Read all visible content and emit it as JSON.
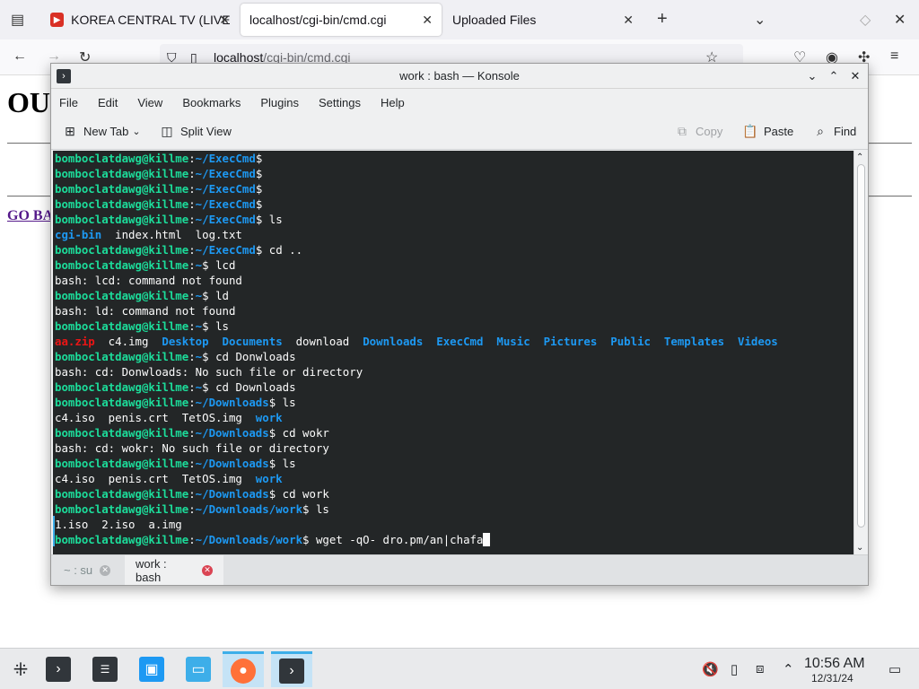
{
  "browser": {
    "tabs": [
      {
        "label": "KOREA CENTRAL TV (LIVES",
        "close": "✕"
      },
      {
        "label": "localhost/cgi-bin/cmd.cgi",
        "close": "✕"
      },
      {
        "label": "Uploaded Files",
        "close": "✕"
      }
    ],
    "new_tab": "+",
    "url_host": "localhost",
    "url_path": "/cgi-bin/cmd.cgi"
  },
  "page": {
    "heading": "OU",
    "link": "GO BA"
  },
  "konsole": {
    "title": "work : bash — Konsole",
    "menu": [
      "File",
      "Edit",
      "View",
      "Bookmarks",
      "Plugins",
      "Settings",
      "Help"
    ],
    "toolbar": {
      "new_tab": "New Tab",
      "split_view": "Split View",
      "copy": "Copy",
      "paste": "Paste",
      "find": "Find"
    },
    "terminal": {
      "user": "bomboclatdawg@killme",
      "lines": [
        {
          "path": "~/ExecCmd",
          "cmd": ""
        },
        {
          "path": "~/ExecCmd",
          "cmd": ""
        },
        {
          "path": "~/ExecCmd",
          "cmd": ""
        },
        {
          "path": "~/ExecCmd",
          "cmd": ""
        },
        {
          "path": "~/ExecCmd",
          "cmd": " ls"
        },
        {
          "out": [
            {
              "t": "cgi-bin",
              "c": "dir"
            },
            {
              "t": "  index.html  log.txt",
              "c": ""
            }
          ]
        },
        {
          "path": "~/ExecCmd",
          "cmd": " cd .."
        },
        {
          "path": "~",
          "cmd": " lcd"
        },
        {
          "out": [
            {
              "t": "bash: lcd: command not found",
              "c": ""
            }
          ]
        },
        {
          "path": "~",
          "cmd": " ld"
        },
        {
          "out": [
            {
              "t": "bash: ld: command not found",
              "c": ""
            }
          ]
        },
        {
          "path": "~",
          "cmd": " ls"
        },
        {
          "out": [
            {
              "t": "aa.zip",
              "c": "arch"
            },
            {
              "t": "  c4.img  ",
              "c": ""
            },
            {
              "t": "Desktop",
              "c": "dir"
            },
            {
              "t": "  ",
              "c": ""
            },
            {
              "t": "Documents",
              "c": "dir"
            },
            {
              "t": "  download  ",
              "c": ""
            },
            {
              "t": "Downloads",
              "c": "dir"
            },
            {
              "t": "  ",
              "c": ""
            },
            {
              "t": "ExecCmd",
              "c": "dir"
            },
            {
              "t": "  ",
              "c": ""
            },
            {
              "t": "Music",
              "c": "dir"
            },
            {
              "t": "  ",
              "c": ""
            },
            {
              "t": "Pictures",
              "c": "dir"
            },
            {
              "t": "  ",
              "c": ""
            },
            {
              "t": "Public",
              "c": "dir"
            },
            {
              "t": "  ",
              "c": ""
            },
            {
              "t": "Templates",
              "c": "dir"
            },
            {
              "t": "  ",
              "c": ""
            },
            {
              "t": "Videos",
              "c": "dir"
            }
          ]
        },
        {
          "path": "~",
          "cmd": " cd Donwloads"
        },
        {
          "out": [
            {
              "t": "bash: cd: Donwloads: No such file or directory",
              "c": ""
            }
          ]
        },
        {
          "path": "~",
          "cmd": " cd Downloads"
        },
        {
          "path": "~/Downloads",
          "cmd": " ls"
        },
        {
          "out": [
            {
              "t": "c4.iso  penis.crt  TetOS.img  ",
              "c": ""
            },
            {
              "t": "work",
              "c": "dir"
            }
          ]
        },
        {
          "path": "~/Downloads",
          "cmd": " cd wokr"
        },
        {
          "out": [
            {
              "t": "bash: cd: wokr: No such file or directory",
              "c": ""
            }
          ]
        },
        {
          "path": "~/Downloads",
          "cmd": " ls"
        },
        {
          "out": [
            {
              "t": "c4.iso  penis.crt  TetOS.img  ",
              "c": ""
            },
            {
              "t": "work",
              "c": "dir"
            }
          ]
        },
        {
          "path": "~/Downloads",
          "cmd": " cd work"
        },
        {
          "path": "~/Downloads/work",
          "cmd": " ls"
        },
        {
          "out": [
            {
              "t": "1.iso  2.iso  a.img",
              "c": ""
            }
          ]
        },
        {
          "path": "~/Downloads/work",
          "cmd": " wget -qO- dro.pm/an|chafa",
          "cursor": true
        }
      ]
    },
    "tabs": [
      {
        "label": "~ : su",
        "close": "✕"
      },
      {
        "label": "work : bash",
        "close": "✕"
      }
    ]
  },
  "taskbar": {
    "clock_time": "10:56 AM",
    "clock_date": "12/31/24"
  },
  "colors": {
    "terminal_bg": "#232627",
    "prompt_user": "#1cdc9a",
    "prompt_path": "#1d99f3",
    "archive": "#ed1515",
    "accent": "#3daee9"
  }
}
